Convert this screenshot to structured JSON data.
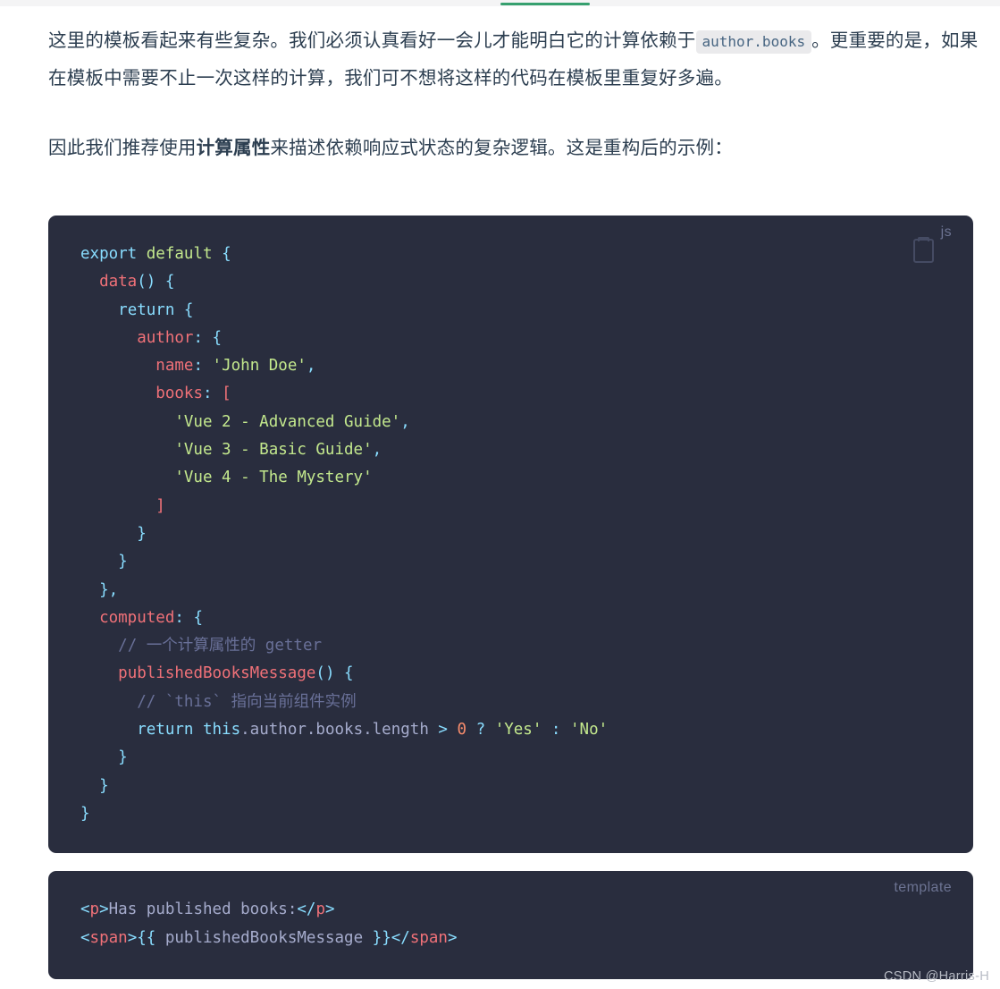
{
  "topbar": {
    "accent_color": "#37a06f",
    "track_color": "#f4f4f5"
  },
  "paragraphs": {
    "p1_part1": "这里的模板看起来有些复杂。我们必须认真看好一会儿才能明白它的计算依赖于",
    "p1_code": "author.books",
    "p1_part2": "。更重要的是，如果在模板中需要不止一次这样的计算，我们可不想将这样的代码在模板里重复好多遍。",
    "p2_part1": "因此我们推荐使用",
    "p2_bold": "计算属性",
    "p2_part2": "来描述依赖响应式状态的复杂逻辑。这是重构后的示例："
  },
  "js_block": {
    "lang_label": "js",
    "copy_icon": "copy-icon",
    "background": "#292d3e",
    "lines": [
      {
        "indent": 0,
        "tokens": [
          {
            "c": "t-kw",
            "t": "export"
          },
          {
            "c": "t-var",
            "t": " "
          },
          {
            "c": "t-kw2",
            "t": "default"
          },
          {
            "c": "t-var",
            "t": " "
          },
          {
            "c": "t-punc",
            "t": "{"
          }
        ]
      },
      {
        "indent": 1,
        "tokens": [
          {
            "c": "t-fn",
            "t": "data"
          },
          {
            "c": "t-punc",
            "t": "()"
          },
          {
            "c": "t-var",
            "t": " "
          },
          {
            "c": "t-punc",
            "t": "{"
          }
        ]
      },
      {
        "indent": 2,
        "tokens": [
          {
            "c": "t-kw",
            "t": "return"
          },
          {
            "c": "t-var",
            "t": " "
          },
          {
            "c": "t-punc",
            "t": "{"
          }
        ]
      },
      {
        "indent": 3,
        "tokens": [
          {
            "c": "t-fn",
            "t": "author"
          },
          {
            "c": "t-punc",
            "t": ":"
          },
          {
            "c": "t-var",
            "t": " "
          },
          {
            "c": "t-punc",
            "t": "{"
          }
        ]
      },
      {
        "indent": 4,
        "tokens": [
          {
            "c": "t-fn",
            "t": "name"
          },
          {
            "c": "t-punc",
            "t": ":"
          },
          {
            "c": "t-var",
            "t": " "
          },
          {
            "c": "t-str",
            "t": "'John Doe'"
          },
          {
            "c": "t-punc",
            "t": ","
          }
        ]
      },
      {
        "indent": 4,
        "tokens": [
          {
            "c": "t-fn",
            "t": "books"
          },
          {
            "c": "t-punc",
            "t": ":"
          },
          {
            "c": "t-var",
            "t": " "
          },
          {
            "c": "t-fn",
            "t": "["
          }
        ]
      },
      {
        "indent": 5,
        "tokens": [
          {
            "c": "t-str",
            "t": "'Vue 2 - Advanced Guide'"
          },
          {
            "c": "t-punc",
            "t": ","
          }
        ]
      },
      {
        "indent": 5,
        "tokens": [
          {
            "c": "t-str",
            "t": "'Vue 3 - Basic Guide'"
          },
          {
            "c": "t-punc",
            "t": ","
          }
        ]
      },
      {
        "indent": 5,
        "tokens": [
          {
            "c": "t-str",
            "t": "'Vue 4 - The Mystery'"
          }
        ]
      },
      {
        "indent": 4,
        "tokens": [
          {
            "c": "t-fn",
            "t": "]"
          }
        ]
      },
      {
        "indent": 3,
        "tokens": [
          {
            "c": "t-punc",
            "t": "}"
          }
        ]
      },
      {
        "indent": 2,
        "tokens": [
          {
            "c": "t-punc",
            "t": "}"
          }
        ]
      },
      {
        "indent": 1,
        "tokens": [
          {
            "c": "t-punc",
            "t": "}"
          },
          {
            "c": "t-punc",
            "t": ","
          }
        ]
      },
      {
        "indent": 1,
        "tokens": [
          {
            "c": "t-fn",
            "t": "computed"
          },
          {
            "c": "t-punc",
            "t": ":"
          },
          {
            "c": "t-var",
            "t": " "
          },
          {
            "c": "t-punc",
            "t": "{"
          }
        ]
      },
      {
        "indent": 2,
        "tokens": [
          {
            "c": "t-com",
            "t": "// 一个计算属性的 getter"
          }
        ]
      },
      {
        "indent": 2,
        "tokens": [
          {
            "c": "t-fn",
            "t": "publishedBooksMessage"
          },
          {
            "c": "t-punc",
            "t": "()"
          },
          {
            "c": "t-var",
            "t": " "
          },
          {
            "c": "t-punc",
            "t": "{"
          }
        ]
      },
      {
        "indent": 3,
        "tokens": [
          {
            "c": "t-com",
            "t": "// `this` 指向当前组件实例"
          }
        ]
      },
      {
        "indent": 3,
        "tokens": [
          {
            "c": "t-kw",
            "t": "return"
          },
          {
            "c": "t-var",
            "t": " "
          },
          {
            "c": "t-this",
            "t": "this"
          },
          {
            "c": "t-var",
            "t": ".author.books.length"
          },
          {
            "c": "t-var",
            "t": " "
          },
          {
            "c": "t-punc",
            "t": ">"
          },
          {
            "c": "t-var",
            "t": " "
          },
          {
            "c": "t-num",
            "t": "0"
          },
          {
            "c": "t-var",
            "t": " "
          },
          {
            "c": "t-punc",
            "t": "?"
          },
          {
            "c": "t-var",
            "t": " "
          },
          {
            "c": "t-str",
            "t": "'Yes'"
          },
          {
            "c": "t-var",
            "t": " "
          },
          {
            "c": "t-punc",
            "t": ":"
          },
          {
            "c": "t-var",
            "t": " "
          },
          {
            "c": "t-str",
            "t": "'No'"
          }
        ]
      },
      {
        "indent": 2,
        "tokens": [
          {
            "c": "t-punc",
            "t": "}"
          }
        ]
      },
      {
        "indent": 1,
        "tokens": [
          {
            "c": "t-punc",
            "t": "}"
          }
        ]
      },
      {
        "indent": 0,
        "tokens": [
          {
            "c": "t-punc",
            "t": "}"
          }
        ]
      }
    ]
  },
  "template_block": {
    "lang_label": "template",
    "background": "#292d3e",
    "lines": [
      {
        "indent": 0,
        "tokens": [
          {
            "c": "t-brk",
            "t": "<"
          },
          {
            "c": "t-tag",
            "t": "p"
          },
          {
            "c": "t-brk",
            "t": ">"
          },
          {
            "c": "t-txt",
            "t": "Has published books:"
          },
          {
            "c": "t-brk",
            "t": "</"
          },
          {
            "c": "t-tag",
            "t": "p"
          },
          {
            "c": "t-brk",
            "t": ">"
          }
        ]
      },
      {
        "indent": 0,
        "tokens": [
          {
            "c": "t-brk",
            "t": "<"
          },
          {
            "c": "t-tag",
            "t": "span"
          },
          {
            "c": "t-brk",
            "t": ">"
          },
          {
            "c": "t-brk",
            "t": "{{"
          },
          {
            "c": "t-txt",
            "t": " publishedBooksMessage "
          },
          {
            "c": "t-brk",
            "t": "}}"
          },
          {
            "c": "t-brk",
            "t": "</"
          },
          {
            "c": "t-tag",
            "t": "span"
          },
          {
            "c": "t-brk",
            "t": ">"
          }
        ]
      }
    ]
  },
  "watermark": {
    "text": "CSDN @Harris-H"
  }
}
